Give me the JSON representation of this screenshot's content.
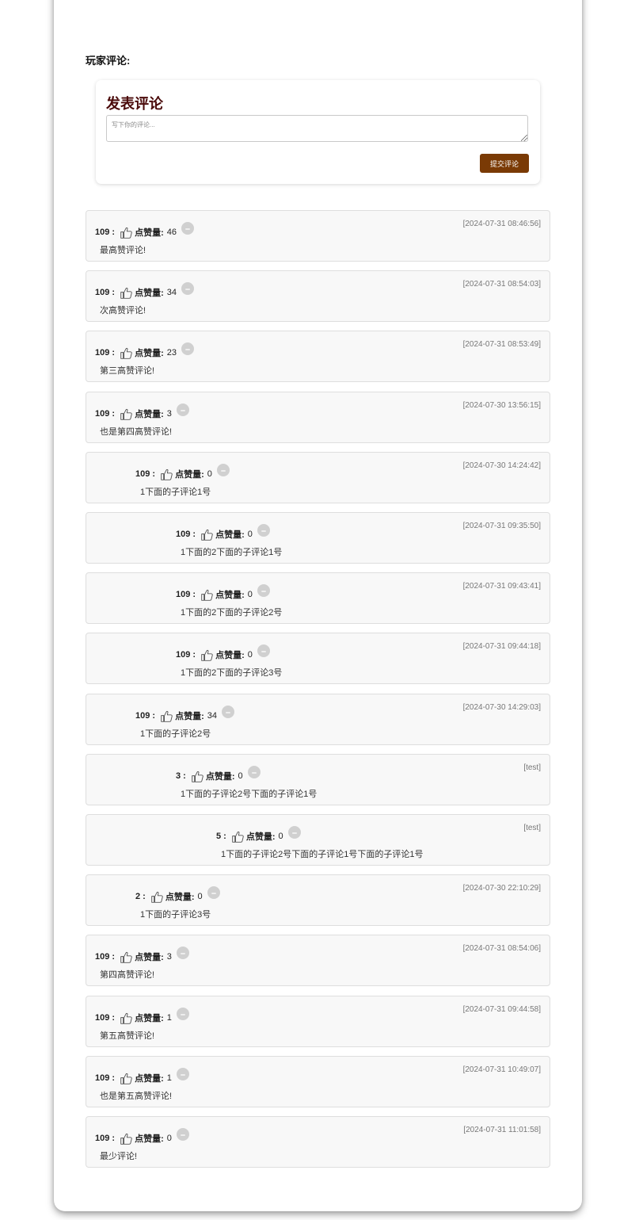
{
  "section_title": "玩家评论:",
  "composer": {
    "title": "发表评论",
    "placeholder": "写下你的评论...",
    "submit_label": "提交评论"
  },
  "like_label": "点赞量:",
  "comments": [
    {
      "user": "109",
      "likes": "46",
      "text": "最高赞评论!",
      "time": "[2024-07-31 08:46:56]",
      "depth": 0
    },
    {
      "user": "109",
      "likes": "34",
      "text": "次高赞评论!",
      "time": "[2024-07-31 08:54:03]",
      "depth": 0
    },
    {
      "user": "109",
      "likes": "23",
      "text": "第三高赞评论!",
      "time": "[2024-07-31 08:53:49]",
      "depth": 0
    },
    {
      "user": "109",
      "likes": "3",
      "text": "也是第四高赞评论!",
      "time": "[2024-07-30 13:56:15]",
      "depth": 0
    },
    {
      "user": "109",
      "likes": "0",
      "text": "1下面的子评论1号",
      "time": "[2024-07-30 14:24:42]",
      "depth": 1
    },
    {
      "user": "109",
      "likes": "0",
      "text": "1下面的2下面的子评论1号",
      "time": "[2024-07-31 09:35:50]",
      "depth": 2
    },
    {
      "user": "109",
      "likes": "0",
      "text": "1下面的2下面的子评论2号",
      "time": "[2024-07-31 09:43:41]",
      "depth": 2
    },
    {
      "user": "109",
      "likes": "0",
      "text": "1下面的2下面的子评论3号",
      "time": "[2024-07-31 09:44:18]",
      "depth": 2
    },
    {
      "user": "109",
      "likes": "34",
      "text": "1下面的子评论2号",
      "time": "[2024-07-30 14:29:03]",
      "depth": 1
    },
    {
      "user": "3",
      "likes": "0",
      "text": "1下面的子评论2号下面的子评论1号",
      "time": "[test]",
      "depth": 2
    },
    {
      "user": "5",
      "likes": "0",
      "text": "1下面的子评论2号下面的子评论1号下面的子评论1号",
      "time": "[test]",
      "depth": 3
    },
    {
      "user": "2",
      "likes": "0",
      "text": "1下面的子评论3号",
      "time": "[2024-07-30 22:10:29]",
      "depth": 1
    },
    {
      "user": "109",
      "likes": "3",
      "text": "第四高赞评论!",
      "time": "[2024-07-31 08:54:06]",
      "depth": 0
    },
    {
      "user": "109",
      "likes": "1",
      "text": "第五高赞评论!",
      "time": "[2024-07-31 09:44:58]",
      "depth": 0
    },
    {
      "user": "109",
      "likes": "1",
      "text": "也是第五高赞评论!",
      "time": "[2024-07-31 10:49:07]",
      "depth": 0
    },
    {
      "user": "109",
      "likes": "0",
      "text": "最少评论!",
      "time": "[2024-07-31 11:01:58]",
      "depth": 0
    }
  ]
}
